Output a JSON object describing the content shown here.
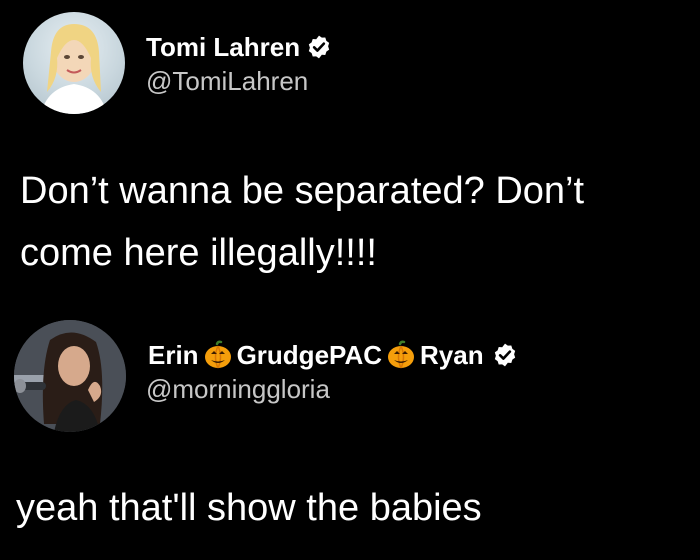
{
  "tweets": [
    {
      "display_name": "Tomi Lahren",
      "verified": true,
      "handle": "@TomiLahren",
      "text_lines": [
        "Don’t wanna be separated? Don’t",
        "come here illegally!!!!"
      ]
    },
    {
      "display_name_parts": [
        "Erin",
        "GrudgePAC",
        "Ryan"
      ],
      "name_emoji": "pumpkin-icon",
      "verified": true,
      "handle": "@morninggloria",
      "text_lines": [
        "yeah that'll show the babies"
      ]
    }
  ],
  "colors": {
    "background": "#000000",
    "text": "#ffffff",
    "handle": "#c7c7c7",
    "verified_badge": "#ffffff",
    "pumpkin": "#f59e0b"
  }
}
